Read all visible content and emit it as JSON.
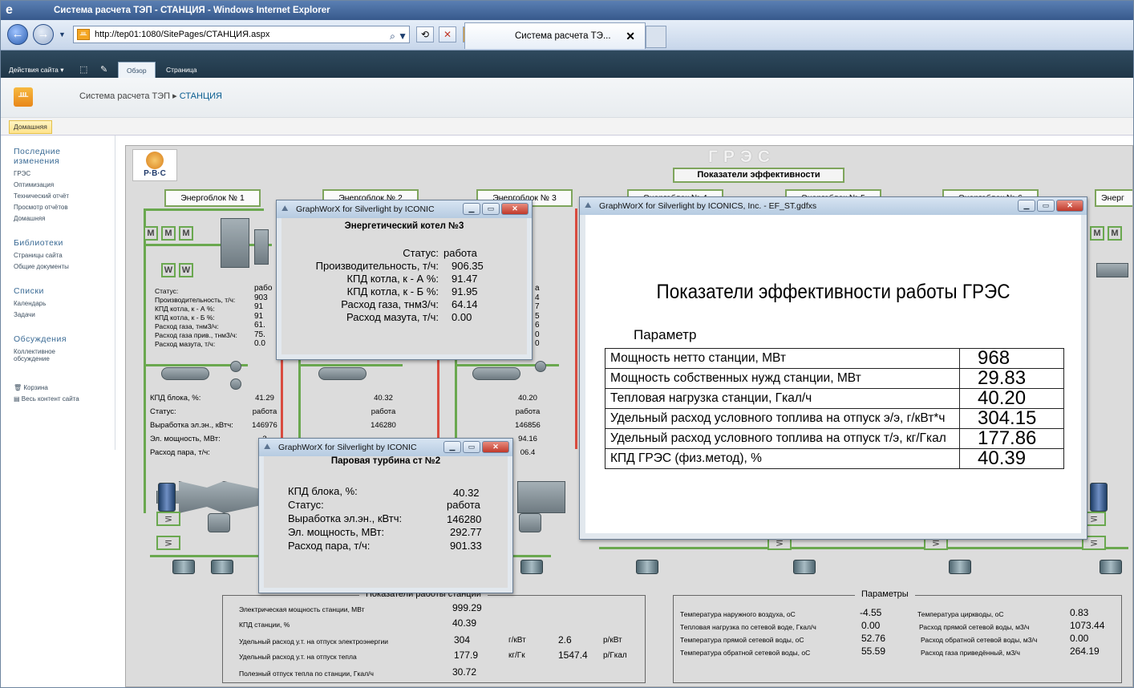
{
  "browser": {
    "title": "Система расчета ТЭП - СТАНЦИЯ - Windows Internet Explorer",
    "address": "http://tep01:1080/SitePages/СТАНЦИЯ.aspx",
    "tab_label": "Система расчета ТЭ..."
  },
  "sp_ribbon": {
    "actions": "Действия сайта ▾",
    "tabs": [
      "Обзор",
      "Страница"
    ]
  },
  "sp_header": {
    "crumb_root": "Система расчета ТЭП",
    "crumb_sep": "▸",
    "crumb_current": "СТАНЦИЯ",
    "home_tab": "Домашняя"
  },
  "quick_launch": {
    "recent_heading": "Последние изменения",
    "recent_items": [
      "ГРЭС",
      "Оптимизация",
      "Технический отчёт",
      "Просмотр отчётов",
      "Домашняя"
    ],
    "libraries_heading": "Библиотеки",
    "libraries_items": [
      "Страницы сайта",
      "Общие документы"
    ],
    "lists_heading": "Списки",
    "lists_items": [
      "Календарь",
      "Задачи"
    ],
    "discussions_heading": "Обсуждения",
    "discussions_items": [
      "Коллективное обсуждение"
    ],
    "bin": "Корзина",
    "all_content": "Весь контент сайта"
  },
  "scada": {
    "logo_text": "Р·В·С",
    "gres_title": "ГРЭС",
    "perf_button": "Показатели эффективности",
    "energoblok": [
      "Энергоблок № 1",
      "Энергоблок № 2",
      "Энергоблок № 3",
      "Энергоблок № 4",
      "Энергоблок № 5",
      "Энергоблок № 6",
      "Энерг"
    ],
    "boiler_labels": [
      "Статус:",
      "Производительность, т/ч:",
      "КПД котла, к - А %:",
      "КПД котла, к - Б %:",
      "Расход газа, тнм3/ч:",
      "Расход газа прив., тнм3/ч:",
      "Расход мазута, т/ч:"
    ],
    "boiler1_vals": [
      "рабо",
      "903",
      "91",
      "91",
      "61.",
      "75.",
      "0.0"
    ],
    "block_labels": [
      "КПД блока, %:",
      "Статус:",
      "Выработка эл.эн., кВтч:",
      "Эл. мощность, МВт:",
      "Расход пара, т/ч:"
    ],
    "block1_vals": [
      "41.29",
      "работа",
      "146976",
      "2",
      ""
    ],
    "block2_vals": [
      "40.32",
      "работа",
      "146280",
      "",
      ""
    ],
    "block3_vals": [
      "40.20",
      "работа",
      "146856",
      "94.16",
      "06.4"
    ],
    "block3_boiler_frag": [
      "а",
      "4",
      "7",
      "5",
      "6",
      "0",
      "0"
    ]
  },
  "station_panel": {
    "title": "Показатели работы станции",
    "rows": [
      {
        "label": "Электрическая мощность станции, МВт",
        "v1": "999.29",
        "u1": "",
        "v2": "",
        "u2": ""
      },
      {
        "label": "КПД станции, %",
        "v1": "40.39",
        "u1": "",
        "v2": "",
        "u2": ""
      },
      {
        "label": "Удельный расход у.т. на отпуск электроэнергии",
        "v1": "304",
        "u1": "г/кВт",
        "v2": "2.6",
        "u2": "р/кВт"
      },
      {
        "label": "Удельный расход у.т. на отпуск тепла",
        "v1": "177.9",
        "u1": "кг/Гк",
        "v2": "1547.4",
        "u2": "р/Гкал"
      },
      {
        "label": "Полезный отпуск тепла по станции, Гкал/ч",
        "v1": "30.72",
        "u1": "",
        "v2": "",
        "u2": ""
      }
    ]
  },
  "params_panel": {
    "title": "Параметры",
    "left": [
      {
        "label": "Температура наружного воздуха, оС",
        "value": "-4.55"
      },
      {
        "label": "Тепловая нагрузка по сетевой воде, Гкал/ч",
        "value": "0.00"
      },
      {
        "label": "Температура прямой сетевой воды, оС",
        "value": "52.76"
      },
      {
        "label": "Температура обратной сетевой воды, оС",
        "value": "55.59"
      }
    ],
    "right": [
      {
        "label": "Температура циркводы, оС",
        "value": "0.83"
      },
      {
        "label": "Расход прямой сетевой воды, м3/ч",
        "value": "1073.44"
      },
      {
        "label": "Расход обратной сетевой воды, м3/ч",
        "value": "0.00"
      },
      {
        "label": "Расход газа приведённый, м3/ч",
        "value": "264.19"
      }
    ]
  },
  "boiler_win": {
    "title": "GraphWorX for Silverlight by ICONIC",
    "heading": "Энергетический котел №3",
    "rows": [
      {
        "label": "Статус:",
        "value": "работа"
      },
      {
        "label": "Производительность, т/ч:",
        "value": "906.35"
      },
      {
        "label": "КПД котла, к - А %:",
        "value": "91.47"
      },
      {
        "label": "КПД котла, к - Б %:",
        "value": "91.95"
      },
      {
        "label": "Расход газа, тнм3/ч:",
        "value": "64.14"
      },
      {
        "label": "Расход мазута, т/ч:",
        "value": "0.00"
      }
    ]
  },
  "turbine_win": {
    "title": "GraphWorX for Silverlight by ICONIC",
    "heading": "Паровая турбина ст №2",
    "rows": [
      {
        "label": "КПД блока, %:",
        "value": "40.32"
      },
      {
        "label": "Статус:",
        "value": "работа"
      },
      {
        "label": "Выработка эл.эн., кВтч:",
        "value": "146280"
      },
      {
        "label": "Эл. мощность, МВт:",
        "value": "292.77"
      },
      {
        "label": "Расход пара, т/ч:",
        "value": "901.33"
      }
    ]
  },
  "eff_win": {
    "title": "GraphWorX for Silverlight by ICONICS, Inc. - EF_ST.gdfxs",
    "heading": "Показатели эффективности работы ГРЭС",
    "param_label": "Параметр",
    "rows": [
      {
        "label": "Мощность нетто станции, МВт",
        "value": "968"
      },
      {
        "label": "Мощность собственных нужд станции, МВт",
        "value": "29.83"
      },
      {
        "label": "Тепловая нагрузка станции, Гкал/ч",
        "value": "40.20"
      },
      {
        "label": "Удельный расход условного топлива на отпуск э/э, г/кВт*ч",
        "value": "304.15"
      },
      {
        "label": "Удельный расход условного топлива на отпуск т/э, кг/Гкал",
        "value": "177.86"
      },
      {
        "label": "КПД ГРЭС (физ.метод), %",
        "value": "40.39"
      }
    ]
  },
  "colors": {
    "pipe_green": "#6aa84f",
    "pipe_red": "#d94b3f",
    "sp_ribbon": "#2f4a5e"
  }
}
